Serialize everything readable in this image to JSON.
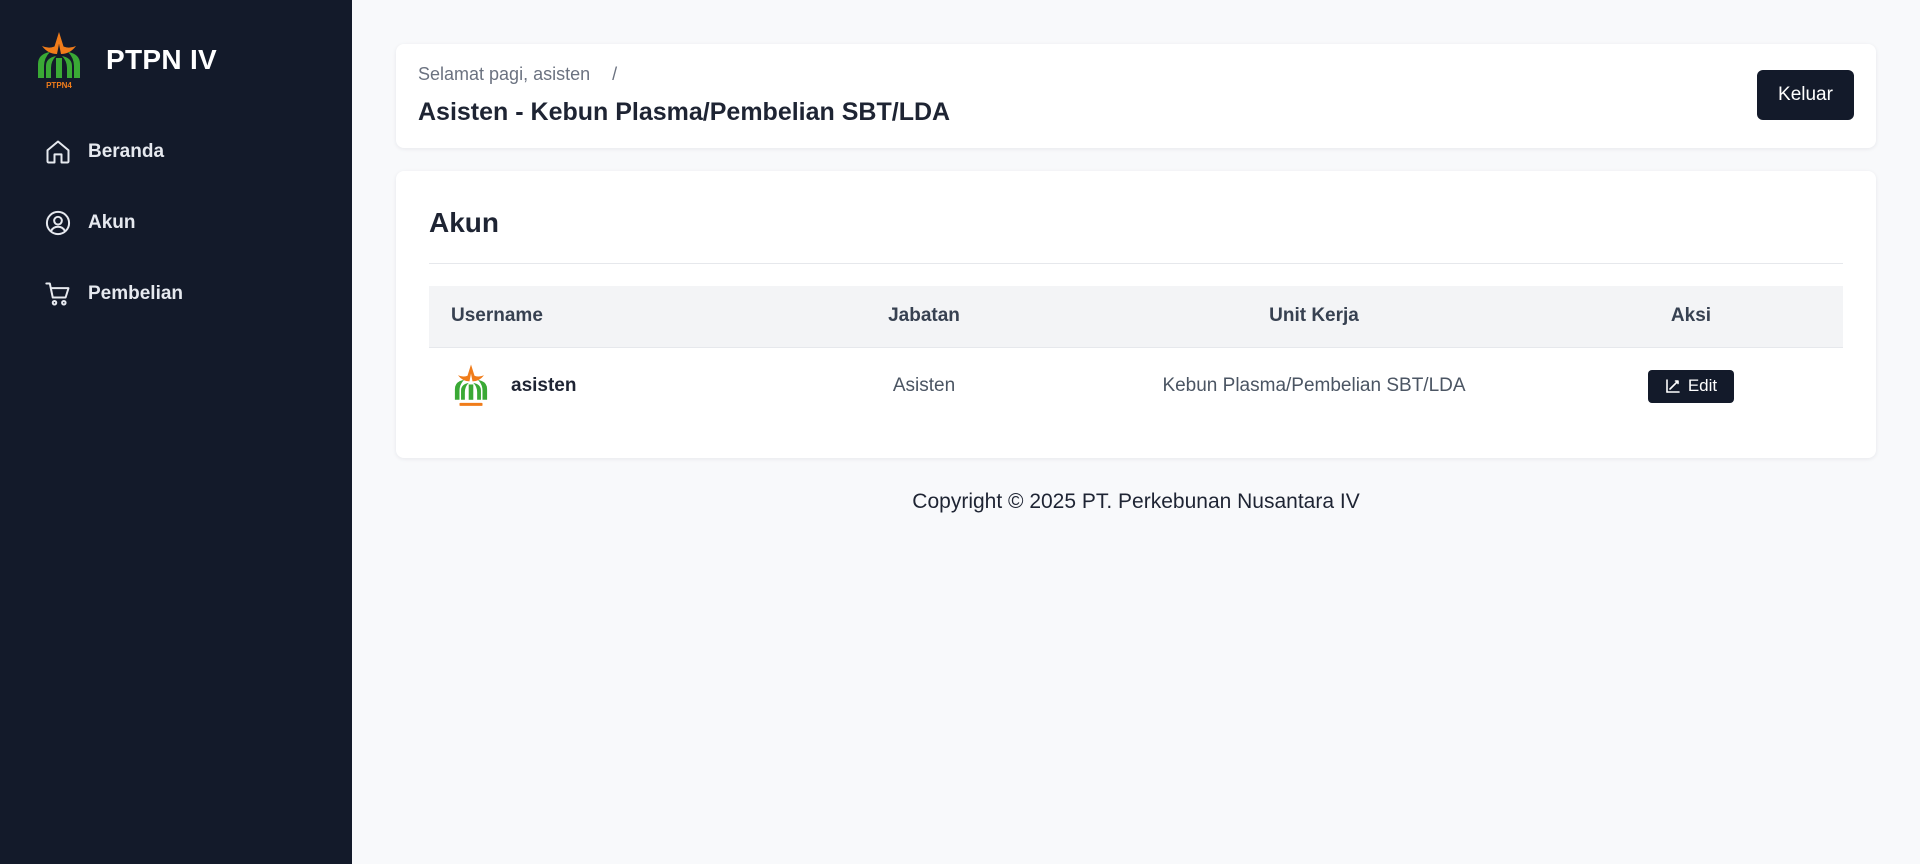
{
  "sidebar": {
    "brand_name": "PTPN IV",
    "logo_caption": "PTPN4",
    "items": [
      {
        "label": "Beranda",
        "icon": "home-icon"
      },
      {
        "label": "Akun",
        "icon": "user-circle-icon"
      },
      {
        "label": "Pembelian",
        "icon": "cart-icon"
      }
    ]
  },
  "header": {
    "greeting": "Selamat pagi, asisten",
    "separator": "/",
    "title": "Asisten - Kebun Plasma/Pembelian SBT/LDA",
    "logout_label": "Keluar"
  },
  "main": {
    "title": "Akun",
    "columns": [
      "Username",
      "Jabatan",
      "Unit Kerja",
      "Aksi"
    ],
    "rows": [
      {
        "username": "asisten",
        "jabatan": "Asisten",
        "unit_kerja": "Kebun Plasma/Pembelian SBT/LDA",
        "action_label": "Edit"
      }
    ]
  },
  "footer": {
    "text": "Copyright © 2025 PT. Perkebunan Nusantara IV"
  },
  "colors": {
    "sidebar_bg": "#131a2a",
    "page_bg": "#f8f9fb",
    "button_bg": "#131a2a",
    "logo_green": "#3aa935",
    "logo_orange": "#f07c1a"
  }
}
